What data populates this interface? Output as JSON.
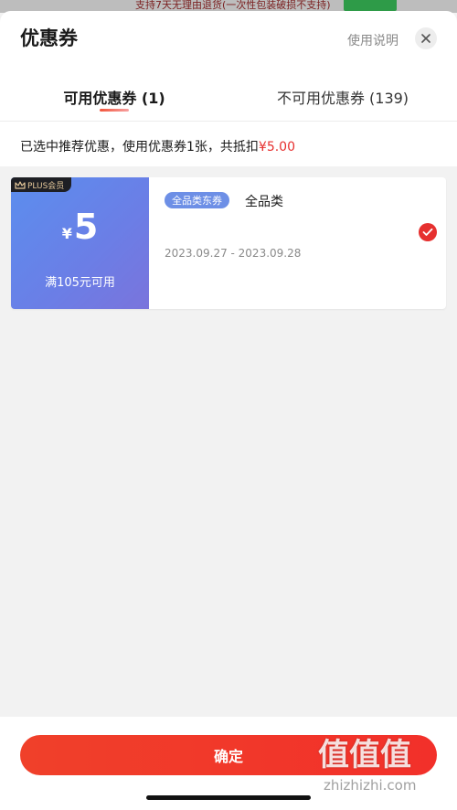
{
  "peek_banner": {
    "text": "支持7天无理由退货(一次性包装破损不支持)"
  },
  "header": {
    "title": "优惠券",
    "help_link": "使用说明"
  },
  "tabs": [
    {
      "label": "可用优惠券 (1)",
      "active": true
    },
    {
      "label": "不可用优惠券 (139)",
      "active": false
    }
  ],
  "summary": {
    "text": "已选中推荐优惠，使用优惠券1张，共抵扣",
    "amount": "¥5.00"
  },
  "coupons": [
    {
      "badge": "PLUS会员",
      "currency": "¥",
      "value": "5",
      "condition": "满105元可用",
      "tag": "全品类东券",
      "category": "全品类",
      "dates": "2023.09.27 - 2023.09.28",
      "selected": true
    }
  ],
  "footer": {
    "confirm_label": "确定"
  },
  "watermark": {
    "glyphs": "值值值",
    "text": "zhizhizhi.com"
  },
  "colors": {
    "accent_red": "#e6302f",
    "coupon_blue": "#6b7ee6",
    "tag_blue": "#6d8fe6",
    "plus_gold": "#e5c89a"
  }
}
